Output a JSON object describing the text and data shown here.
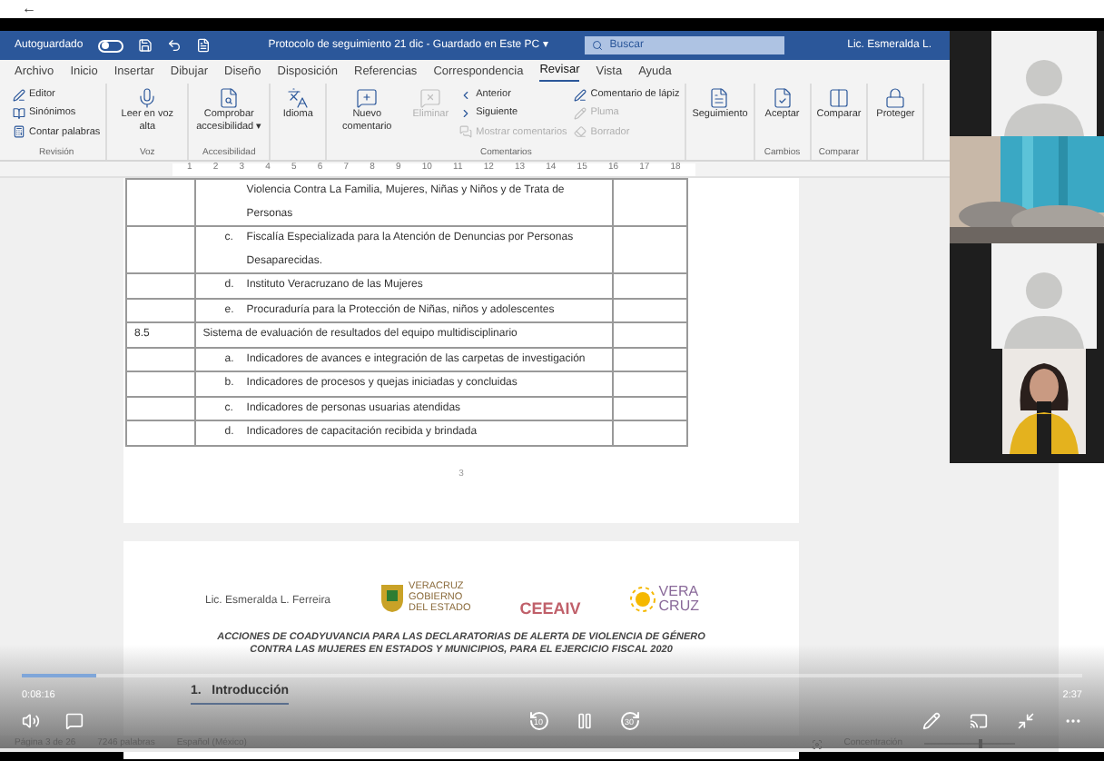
{
  "top_bar": {
    "back": "←"
  },
  "title_bar": {
    "autosave_label": "Autoguardado",
    "autosave_on": false,
    "document_title": "Protocolo de seguimiento 21 dic - Guardado en Este PC ▾",
    "search_placeholder": "Buscar",
    "user": "Lic. Esmeralda L."
  },
  "tabs": [
    {
      "label": "Archivo",
      "selected": false
    },
    {
      "label": "Inicio",
      "selected": false
    },
    {
      "label": "Insertar",
      "selected": false
    },
    {
      "label": "Dibujar",
      "selected": false
    },
    {
      "label": "Diseño",
      "selected": false
    },
    {
      "label": "Disposición",
      "selected": false
    },
    {
      "label": "Referencias",
      "selected": false
    },
    {
      "label": "Correspondencia",
      "selected": false
    },
    {
      "label": "Revisar",
      "selected": true
    },
    {
      "label": "Vista",
      "selected": false
    },
    {
      "label": "Ayuda",
      "selected": false
    }
  ],
  "ribbon_groups": [
    {
      "label": "Revisión",
      "items": [
        {
          "label": "Editor",
          "kind": "small",
          "disabled": false
        },
        {
          "label": "Sinónimos",
          "kind": "small",
          "disabled": false
        },
        {
          "label": "Contar palabras",
          "kind": "small",
          "disabled": false
        }
      ]
    },
    {
      "label": "Voz",
      "items": [
        {
          "label": "Leer en voz alta",
          "kind": "large",
          "disabled": false
        }
      ]
    },
    {
      "label": "Accesibilidad",
      "items": [
        {
          "label": "Comprobar accesibilidad ▾",
          "kind": "large",
          "disabled": false
        }
      ]
    },
    {
      "items": [
        {
          "label": "Idioma",
          "kind": "large",
          "disabled": false
        }
      ]
    },
    {
      "label": "Comentarios",
      "items": [
        {
          "label": "Nuevo comentario",
          "kind": "large",
          "disabled": false
        },
        {
          "label": "Eliminar",
          "kind": "large",
          "disabled": true
        },
        {
          "label": "Anterior",
          "kind": "small",
          "disabled": false
        },
        {
          "label": "Siguiente",
          "kind": "small",
          "disabled": false
        },
        {
          "label": "Mostrar comentarios",
          "kind": "small",
          "disabled": true
        },
        {
          "label": "Comentario de lápiz",
          "kind": "small",
          "disabled": false
        },
        {
          "label": "Pluma",
          "kind": "small",
          "disabled": true
        },
        {
          "label": "Borrador",
          "kind": "small",
          "disabled": true
        }
      ]
    },
    {
      "items": [
        {
          "label": "Seguimiento",
          "kind": "large",
          "disabled": false
        }
      ]
    },
    {
      "label": "Cambios",
      "items": [
        {
          "label": "Aceptar",
          "kind": "large",
          "disabled": false
        }
      ]
    },
    {
      "label": "Comparar",
      "items": [
        {
          "label": "Comparar",
          "kind": "large",
          "disabled": false
        }
      ]
    },
    {
      "items": [
        {
          "label": "Proteger",
          "kind": "large",
          "disabled": false
        }
      ]
    }
  ],
  "ruler": {
    "numbers": [
      "1",
      "2",
      "3",
      "4",
      "5",
      "6",
      "7",
      "8",
      "9",
      "10",
      "11",
      "12",
      "13",
      "14",
      "15",
      "16",
      "17",
      "18"
    ]
  },
  "table": {
    "rows": [
      {
        "number": "",
        "letter": "",
        "text": "Violencia Contra La Familia, Mujeres, Niñas y Niños y de Trata de Personas"
      },
      {
        "number": "",
        "letter": "c.",
        "text": "Fiscalía Especializada para la Atención de Denuncias por Personas Desaparecidas."
      },
      {
        "number": "",
        "letter": "d.",
        "text": "Instituto Veracruzano de las Mujeres"
      },
      {
        "number": "",
        "letter": "e.",
        "text": "Procuraduría para la Protección de Niñas, niños y adolescentes"
      },
      {
        "number": "8.5",
        "letter": "",
        "text": "Sistema de evaluación de resultados del equipo multidisciplinario"
      },
      {
        "number": "",
        "letter": "a.",
        "text": "Indicadores de avances e integración de las carpetas de investigación"
      },
      {
        "number": "",
        "letter": "b.",
        "text": "Indicadores de procesos y quejas iniciadas y concluidas"
      },
      {
        "number": "",
        "letter": "c.",
        "text": "Indicadores de personas usuarias atendidas"
      },
      {
        "number": "",
        "letter": "d.",
        "text": "Indicadores de capacitación recibida y brindada"
      }
    ]
  },
  "page_number": "3",
  "next_page": {
    "logos": [
      {
        "kind": "shield",
        "lines": [
          "VERACRUZ",
          "GOBIERNO",
          "DEL ESTADO"
        ]
      },
      {
        "kind": "ceeaiv",
        "lines": [
          "CEEAIV"
        ]
      },
      {
        "kind": "sun",
        "lines": [
          "VERA",
          "CRUZ"
        ]
      }
    ],
    "author": "Lic. Esmeralda L. Ferreira",
    "heading": "ACCIONES DE COADYUVANCIA PARA LAS DECLARATORIAS DE ALERTA DE VIOLENCIA DE GÉNERO CONTRA LAS MUJERES EN ESTADOS Y MUNICIPIOS, PARA EL EJERCICIO FISCAL 2020",
    "section": "1.   Introducción"
  },
  "status_bar": {
    "page": "Página 3 de 26",
    "words": "7246 palabras",
    "language": "Español (México)",
    "focus": "Concentración",
    "level": 0.6
  },
  "participants": [
    {
      "kind": "avatar"
    },
    {
      "kind": "video"
    },
    {
      "kind": "avatar"
    },
    {
      "kind": "video"
    }
  ],
  "player": {
    "elapsed": "0:08:16",
    "remaining": "2:37",
    "level": 0.07,
    "playing": true,
    "rewind": "10",
    "forward": "30"
  }
}
